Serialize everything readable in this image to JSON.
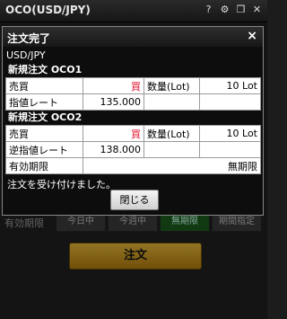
{
  "window": {
    "title": "OCO(USD/JPY)",
    "icons": [
      "help-icon",
      "gear-icon",
      "restore-icon",
      "close-icon"
    ]
  },
  "background": {
    "expiry_label": "有効期限",
    "periods": [
      {
        "label": "今日中",
        "active": false
      },
      {
        "label": "今週中",
        "active": false
      },
      {
        "label": "無期限",
        "active": true
      },
      {
        "label": "期間指定",
        "active": false
      }
    ],
    "order_button": "注文"
  },
  "dialog": {
    "title": "注文完了",
    "close_glyph": "×",
    "pair": "USD/JPY",
    "order1": {
      "header": "新規注文 OCO1",
      "side_label": "売買",
      "side_value": "買",
      "qty_label": "数量(Lot)",
      "qty_value": "10 Lot",
      "price_label": "指値レート",
      "price_value": "135.000"
    },
    "order2": {
      "header": "新規注文 OCO2",
      "side_label": "売買",
      "side_value": "買",
      "qty_label": "数量(Lot)",
      "qty_value": "10 Lot",
      "price_label": "逆指値レート",
      "price_value": "138.000",
      "expiry_label": "有効期限",
      "expiry_value": "無期限"
    },
    "message": "注文を受け付けました。",
    "close_button": "閉じる"
  },
  "colors": {
    "buy": "#e0102c",
    "order_button": "#d4a22a",
    "active_period": "#1c5a1c"
  }
}
